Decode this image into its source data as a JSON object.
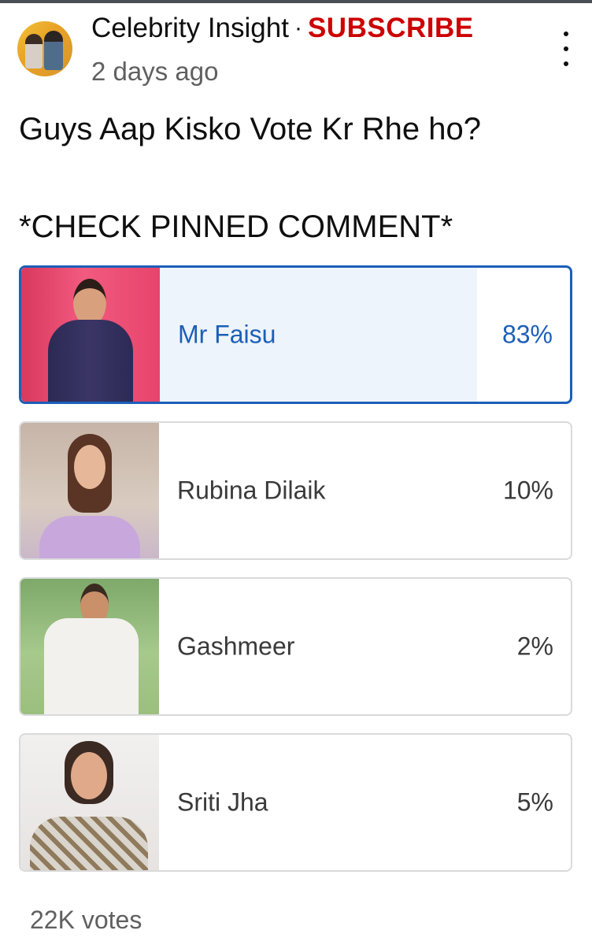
{
  "header": {
    "channel_name": "Celebrity Insight",
    "separator": "·",
    "subscribe_label": "SUBSCRIBE",
    "timestamp": "2 days ago"
  },
  "post": {
    "line1": "Guys Aap Kisko Vote Kr Rhe ho?",
    "line2": "*CHECK PINNED COMMENT*"
  },
  "poll": {
    "options": [
      {
        "label": "Mr Faisu",
        "percent": "83%",
        "share": 0.83,
        "selected": true
      },
      {
        "label": "Rubina Dilaik",
        "percent": "10%",
        "share": 0.1,
        "selected": false
      },
      {
        "label": "Gashmeer",
        "percent": "2%",
        "share": 0.02,
        "selected": false
      },
      {
        "label": "Sriti Jha",
        "percent": "5%",
        "share": 0.05,
        "selected": false
      }
    ],
    "votes": "22K votes"
  },
  "colors": {
    "subscribe": "#cc0000",
    "selected_accent": "#1c5fb8"
  },
  "icons": {
    "menu": "more-vertical-icon"
  }
}
